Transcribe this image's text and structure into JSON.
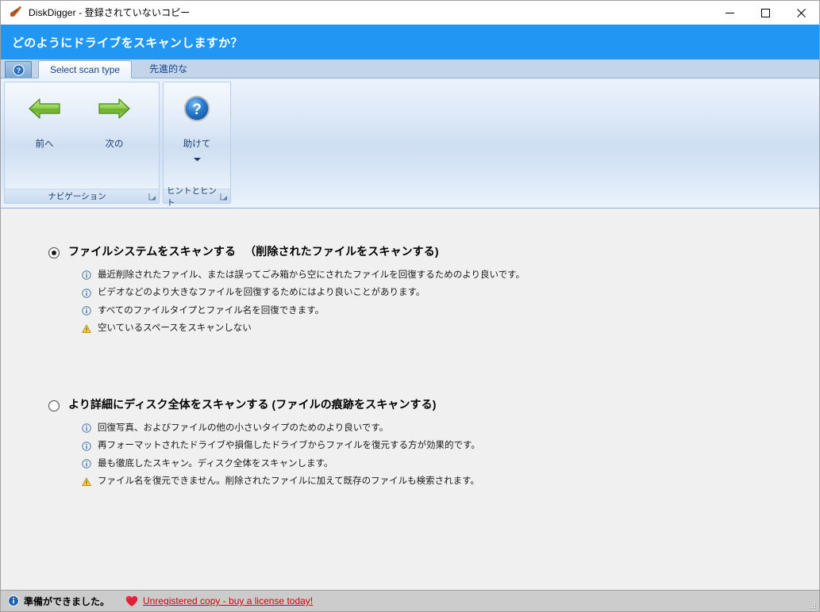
{
  "window": {
    "title": "DiskDigger - 登録されていないコピー",
    "app_icon": "shovel-icon",
    "controls": {
      "minimize": "─",
      "maximize": "☐",
      "close": "✕"
    }
  },
  "header": {
    "title": "どのようにドライブをスキャンしますか？",
    "accent_color": "#2196f3"
  },
  "tabs": {
    "help_button_glyph": "?",
    "items": [
      {
        "label": "Select scan type",
        "active": true
      },
      {
        "label": "先進的な",
        "active": false
      }
    ]
  },
  "ribbon": {
    "groups": [
      {
        "name": "ナビゲーション",
        "buttons": [
          {
            "label": "前へ",
            "icon": "arrow-left-green-icon",
            "has_dropdown": false
          },
          {
            "label": "次の",
            "icon": "arrow-right-green-icon",
            "has_dropdown": false
          }
        ]
      },
      {
        "name": "ヒントとヒント",
        "buttons": [
          {
            "label": "助けて",
            "icon": "help-question-icon",
            "has_dropdown": true
          }
        ]
      }
    ]
  },
  "main": {
    "options": [
      {
        "selected": true,
        "title": "ファイルシステムをスキャンする 　（削除されたファイルをスキャンする)",
        "bullets": [
          {
            "type": "info",
            "text": "最近削除されたファイル、または誤ってごみ箱から空にされたファイルを回復するためのより良いです。"
          },
          {
            "type": "info",
            "text": "ビデオなどのより大きなファイルを回復するためにはより良いことがあります。"
          },
          {
            "type": "info",
            "text": "すべてのファイルタイプとファイル名を回復できます。"
          },
          {
            "type": "warning",
            "text": "空いているスペースをスキャンしない"
          }
        ]
      },
      {
        "selected": false,
        "title": "より詳細にディスク全体をスキャンする (ファイルの痕跡をスキャンする)",
        "bullets": [
          {
            "type": "info",
            "text": "回復写真、およびファイルの他の小さいタイプのためのより良いです。"
          },
          {
            "type": "info",
            "text": "再フォーマットされたドライブや損傷したドライブからファイルを復元する方が効果的です。"
          },
          {
            "type": "info",
            "text": "最も徹底したスキャン。ディスク全体をスキャンします。"
          },
          {
            "type": "warning",
            "text": "ファイル名を復元できません。削除されたファイルに加えて既存のファイルも検索されます。"
          }
        ]
      }
    ]
  },
  "statusbar": {
    "status_icon": "info-icon",
    "status_text": "準備ができました。",
    "heart_icon": "heart-icon",
    "license_link": "Unregistered copy - buy a license today!",
    "link_color": "#d4000b"
  }
}
